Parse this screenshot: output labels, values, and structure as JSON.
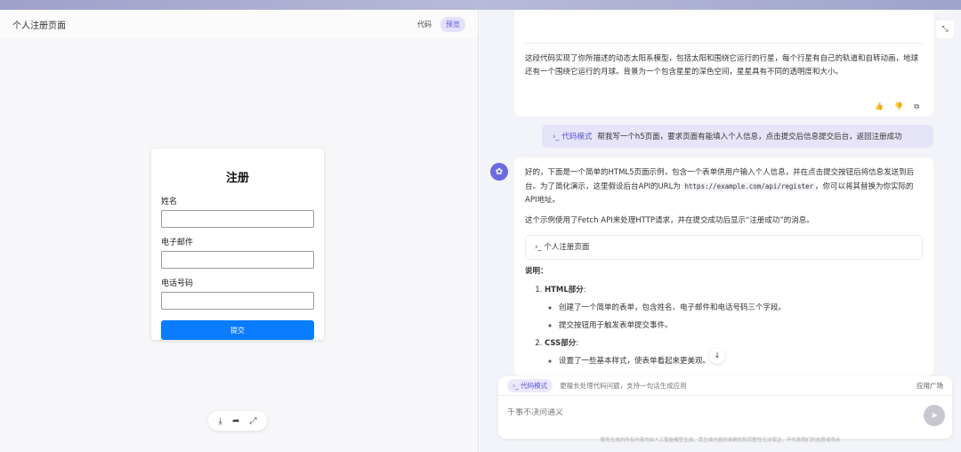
{
  "preview": {
    "title": "个人注册页面",
    "tab_code": "代码",
    "tab_preview": "预览",
    "form": {
      "heading": "注册",
      "name_label": "姓名",
      "email_label": "电子邮件",
      "phone_label": "电话号码",
      "submit_label": "提交"
    },
    "tools": {
      "download_icon": "⤓",
      "share_icon": "➦",
      "fullscreen_icon": "⤢"
    }
  },
  "chat": {
    "collapse_icon": "⤡",
    "prev_answer": "这段代码实现了你所描述的动态太阳系模型，包括太阳和围绕它运行的行星，每个行星有自己的轨道和自转动画，地球还有一个围绕它运行的月球。背景为一个包含星星的深色空间，星星具有不同的透明度和大小。",
    "actions": {
      "like": "👍",
      "dislike": "👎",
      "copy": "⧉"
    },
    "user_message": {
      "tag": "›_ 代码模式",
      "text": "帮我写一个h5页面，要求页面有能填入个人信息，点击提交后信息提交后台，返回注册成功"
    },
    "answer": {
      "p1_a": "好的，下面是一个简单的HTML5页面示例，包含一个表单供用户输入个人信息，并在点击提交按钮后将信息发送到后台。为了简化演示，这里假设后台API的URL为 ",
      "p1_code": "https://example.com/api/register",
      "p1_b": "，你可以将其替换为你实际的API地址。",
      "p2": "这个示例使用了Fetch API来处理HTTP请求，并在提交成功后显示“注册成功”的消息。",
      "artifact": "›_  个人注册页面",
      "explain_title": "说明：",
      "items": [
        {
          "title": "HTML部分",
          "subs": [
            "创建了一个简单的表单，包含姓名、电子邮件和电话号码三个字段。",
            "提交按钮用于触发表单提交事件。"
          ]
        },
        {
          "title": "CSS部分",
          "subs": [
            "设置了一些基本样式，使表单看起来更美观。"
          ]
        }
      ]
    },
    "scroll_down_icon": "↓",
    "input": {
      "mode_tag": "›_ 代码模式",
      "hint": "更擅长处理代码问题，支持一句话生成应用",
      "apps_label": "应用广场",
      "placeholder": "千事不决问通义",
      "send_icon": "➤"
    },
    "disclaimer": "服务生成的所有内容均由人工智能模型生成，其生成内容的准确性和完整性无法保证，不代表我们的态度或观点"
  }
}
